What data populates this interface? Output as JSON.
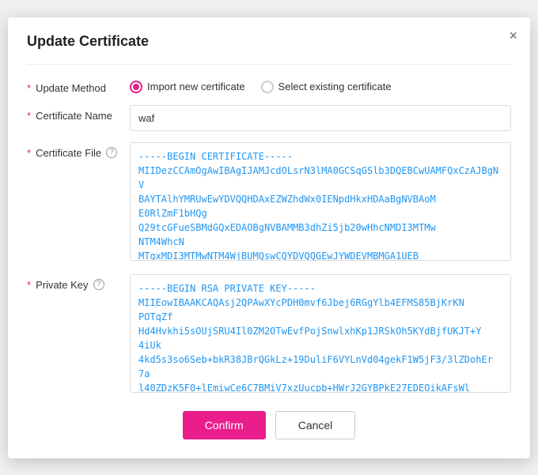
{
  "dialog": {
    "title": "Update Certificate",
    "close_label": "×"
  },
  "form": {
    "update_method": {
      "label": "Update Method",
      "option1_label": "Import new certificate",
      "option1_value": "import",
      "option2_label": "Select existing certificate",
      "option2_value": "existing",
      "selected": "import"
    },
    "certificate_name": {
      "label": "Certificate Name",
      "value": "waf",
      "placeholder": ""
    },
    "certificate_file": {
      "label": "Certificate File",
      "value": "-----BEGIN CERTIFICATE-----\nMIIDezCCAmOgAwIBAgIJAMJcdOLsrN3lMA0GCSqGSlb3DQEBCwUAMFQxCzAJBgNV\nBAYTAlhYMRUwEwYDVQQHDAxEZWZhdWx0IENpdHkxHDAaBgNVBAoM\nE0RlZmF1bHQg\nQ29tcGFueSBMdGQxEDAOBgNVBAMMB3dhZi5jb20wHhcNMDI3MTMw\nNTM4WhcN\nMTgxMDI3MTMwNTM4WjBUMQswCQYDVQQGEwJYWDEVMBMGA1UEB\nwwMRGVmYXVsdCBD\naXR5MRwwGgYDVQQKDBNEZWZhdWx0IENvbXBhbnkgTHRkMRAwDgYD"
    },
    "private_key": {
      "label": "Private Key",
      "value": "-----BEGIN RSA PRIVATE KEY-----\nMIIEowIBAAKCAQAsj2QPAwXYcPDH0mvf6Jbej6RGgYlb4EFMS85BjKrKN\nPOTqZf\nHd4Hvkhi5sOUjSRU4Il0ZM2OTwEvfPojSnwlxhKp1JRSkOh5KYdBjfUKJT+Y\n4iUk\n4kd5s3so6Seb+bkR38JBrQGkLz+19DuliF6VYLnVd04gekF1W5jF3/3lZDohEr\n7a\nl40ZDzK5F0+lEmiwCe6C7BMiV7xzUucpb+HWrJ2GYBPkE27EDEOikAFsWl\neU4wSi\nl+EJQlAdQPF/9exTqg+BF1SGr5701Kezgj8lzBSYO1ZRLlRD2KQEpWtCoMq"
    }
  },
  "actions": {
    "confirm_label": "Confirm",
    "cancel_label": "Cancel"
  }
}
